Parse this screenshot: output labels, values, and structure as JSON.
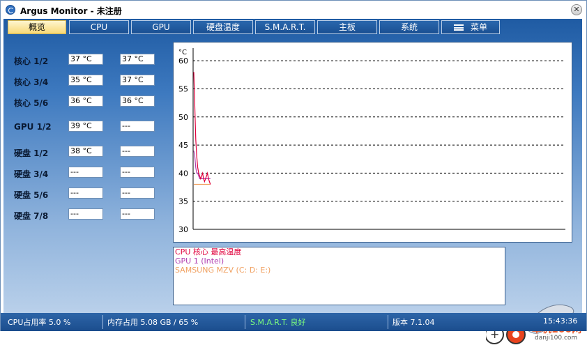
{
  "window": {
    "title": "Argus Monitor - 未注册"
  },
  "tabs": [
    "概览",
    "CPU",
    "GPU",
    "硬盘温度",
    "S.M.A.R.T.",
    "主板",
    "系统",
    "菜单"
  ],
  "temps": [
    {
      "label": "核心 1/2",
      "a": "37 °C",
      "b": "37 °C"
    },
    {
      "label": "核心 3/4",
      "a": "35 °C",
      "b": "37 °C"
    },
    {
      "label": "核心 5/6",
      "a": "36 °C",
      "b": "36 °C"
    },
    {
      "label": "GPU 1/2",
      "a": "39 °C",
      "b": "---"
    },
    {
      "label": "硬盘 1/2",
      "a": "38 °C",
      "b": "---"
    },
    {
      "label": "硬盘 3/4",
      "a": "---",
      "b": "---"
    },
    {
      "label": "硬盘 5/6",
      "a": "---",
      "b": "---"
    },
    {
      "label": "硬盘 7/8",
      "a": "---",
      "b": "---"
    }
  ],
  "chart_data": {
    "type": "line",
    "ylabel": "°C",
    "ylim": [
      30,
      62
    ],
    "yticks": [
      "60",
      "55",
      "50",
      "45",
      "40",
      "35",
      "30"
    ],
    "grid": true,
    "series": [
      {
        "name": "CPU 核心 最高温度",
        "color": "#e0003c",
        "values": [
          58,
          52,
          46,
          43,
          41,
          40,
          39.5,
          39,
          39.5,
          40,
          39,
          38.5,
          39,
          39.5,
          40,
          39,
          38.5,
          38
        ]
      },
      {
        "name": "GPU 1 (Intel)",
        "color": "#b03cb0",
        "values": [
          44,
          43,
          41,
          40,
          40,
          39.5,
          39,
          39,
          39,
          39,
          39,
          39,
          39,
          39,
          39,
          39,
          39,
          39
        ]
      },
      {
        "name": "SAMSUNG MZV (C: D: E:)",
        "color": "#f0a060",
        "values": [
          38,
          38,
          38,
          38,
          38,
          38,
          38,
          38,
          38,
          38,
          38,
          38,
          38,
          38,
          38,
          38,
          38,
          38
        ]
      }
    ]
  },
  "status": {
    "cpu": "CPU占用率 5.0 %",
    "mem": "内存占用 5.08 GB / 65 %",
    "smart": "S.M.A.R.T. 良好",
    "version": "版本 7.1.04",
    "time": "15:43:36",
    "smart_color": "#7dff7d"
  },
  "watermark": {
    "text": "单机100网",
    "sub": "danji100.com"
  }
}
